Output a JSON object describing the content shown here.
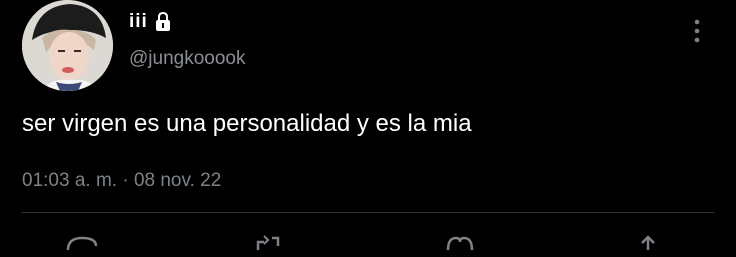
{
  "tweet": {
    "display_name": "iii",
    "handle": "@jungkooook",
    "text": "ser virgen es una personalidad y es la mia",
    "time": "01:03 a. m.",
    "separator": "·",
    "date": "08 nov. 22"
  },
  "icons": {
    "lock": "lock-icon",
    "more": "more-vertical-icon",
    "reply": "reply-icon",
    "retweet": "retweet-icon",
    "like": "like-icon",
    "share": "share-icon"
  },
  "colors": {
    "background": "#000000",
    "text": "#ffffff",
    "secondary_text": "#7d8287",
    "divider": "#2f3336"
  }
}
